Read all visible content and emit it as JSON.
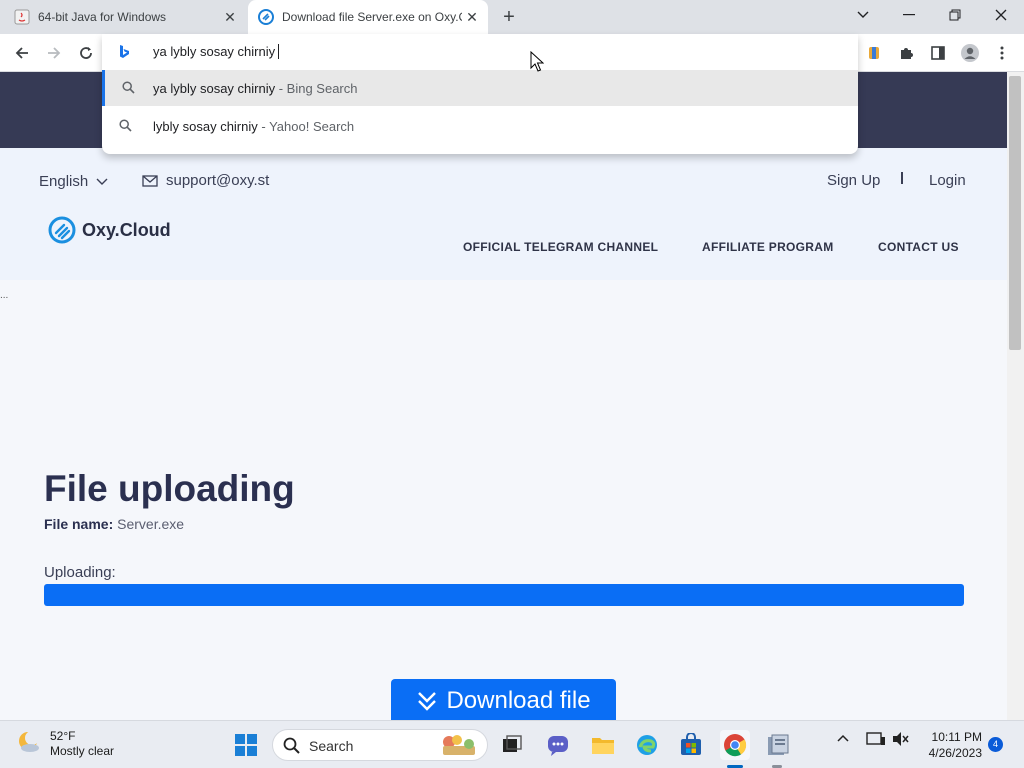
{
  "browser": {
    "tabs": [
      {
        "title": "64-bit Java for Windows",
        "active": false
      },
      {
        "title": "Download file Server.exe on Oxy.Cloud",
        "active": true
      }
    ],
    "omnibox": {
      "input": "ya lybly sosay chirniy",
      "suggestions": [
        {
          "query": "ya lybly sosay chirniy",
          "engine": "- Bing Search",
          "selected": true
        },
        {
          "query": "lybly sosay chirniy",
          "engine": " - Yahoo! Search",
          "selected": false
        }
      ]
    }
  },
  "site": {
    "language": "English",
    "support_email": "support@oxy.st",
    "signup": "Sign Up",
    "separator": "I",
    "login": "Login",
    "logo_text": "Oxy.Cloud",
    "nav": [
      "OFFICIAL TELEGRAM CHANNEL",
      "AFFILIATE PROGRAM",
      "CONTACT US"
    ],
    "ellipsis": "..."
  },
  "main": {
    "heading": "File uploading",
    "file_label": "File name:",
    "file_name": "Server.exe",
    "uploading_label": "Uploading:",
    "progress_percent": 100,
    "download_button": "Download file"
  },
  "taskbar": {
    "weather_temp": "52°F",
    "weather_desc": "Mostly clear",
    "search_label": "Search",
    "time": "10:11 PM",
    "date": "4/26/2023",
    "notification_count": "4"
  },
  "colors": {
    "accent": "#0a6ef5",
    "dark_strip": "#363a55",
    "heading": "#2b3050"
  }
}
